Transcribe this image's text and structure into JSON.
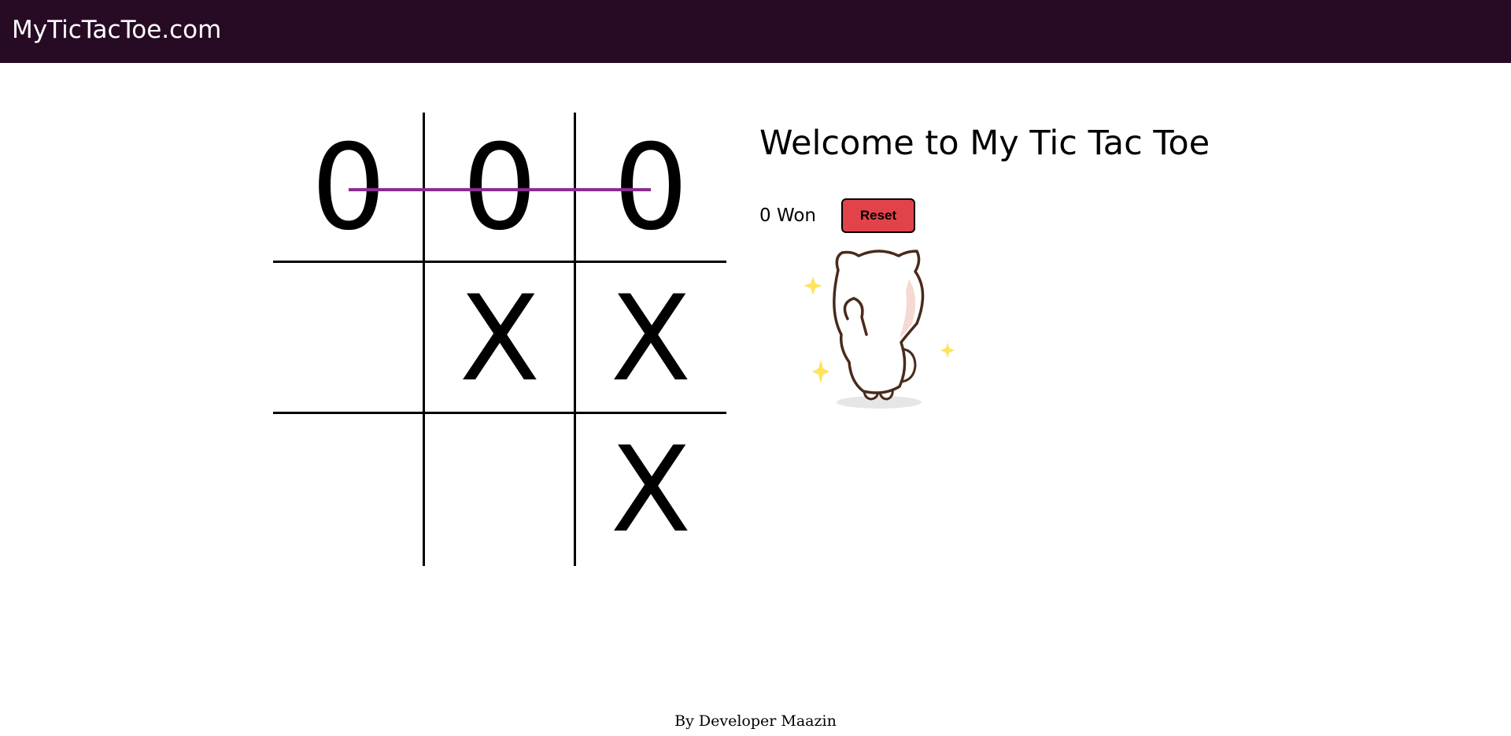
{
  "navbar": {
    "brand": "MyTicTacToe.com"
  },
  "board": {
    "cells": [
      [
        "0",
        "0",
        "0"
      ],
      [
        "",
        "X",
        "X"
      ],
      [
        "",
        "",
        "X"
      ]
    ],
    "winning_line": "row-1",
    "winning_line_color": "#8b2d8f"
  },
  "info": {
    "title": "Welcome to My Tic Tac Toe",
    "score": "0 Won",
    "reset_label": "Reset"
  },
  "image": {
    "icon": "waving-cat-icon"
  },
  "footer": {
    "credit": "By Developer Maazin"
  },
  "colors": {
    "navbar_bg": "#270b25",
    "reset_bg": "#e2434b"
  }
}
